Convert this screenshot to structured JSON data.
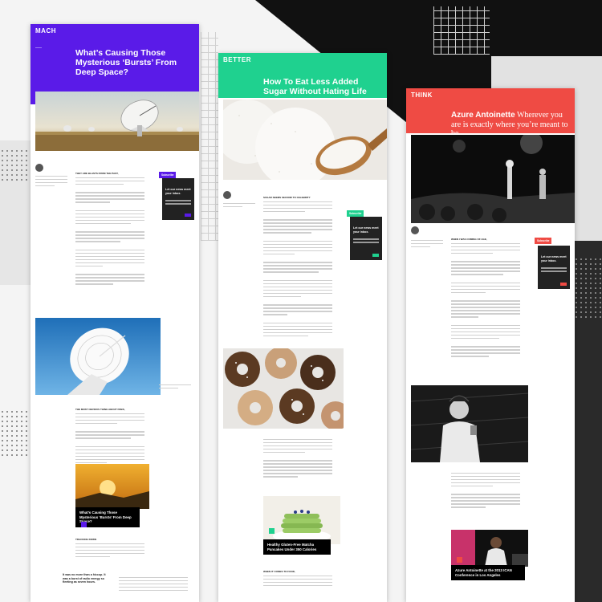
{
  "colors": {
    "mach": "#5a1be8",
    "better": "#1fd18f",
    "think": "#ef4b44",
    "dark": "#111111"
  },
  "mach_card": {
    "brand": "MACH",
    "title": "What’s Causing Those Mysterious ‘Bursts’ From Deep Space?",
    "byline": "JAN 15 · 4 MIN READ",
    "subscribe_tag": "Subscribe",
    "subscribe_text": "Let our news meet your inbox.",
    "lead_caps": "THEY ARE BLASTS FROM THE PAST,",
    "section2_caps": "THE MOST OBVIOUS THING ABOUT FRBS,",
    "section3_caps": "TRACKING DOWN",
    "pull_quote": "It was no more than a hiccup. It was a burst of radio energy so fleeting as seven hours.",
    "related_title": "What’s Causing Those Mysterious ‘Bursts’ From Deep Space?"
  },
  "better_card": {
    "brand": "BETTER",
    "title": "How To Eat Less Added Sugar Without Hating Life",
    "subscribe_tag": "Subscribe",
    "subscribe_text": "Let our news meet your inbox.",
    "lead_caps": "SUGAR SEEMS SECOND TO CELEBRITY",
    "section2_caps": "WHEN IT COMES TO FOOD,",
    "related_title": "Healthy Gluten-Free Matcha Pancakes Under 350 Calories"
  },
  "think_card": {
    "brand": "THINK",
    "title_name": "Azure Antoinette",
    "title_rest": "Wherever you are is exactly where you’re meant to be.",
    "subscribe_tag": "Subscribe",
    "subscribe_text": "Let our news meet your inbox.",
    "lead_caps": "WHEN I WAS COMING OF AGE,",
    "related_title": "Azure Antoinette at the 2013 ICAN Conference in Los Angeles"
  }
}
